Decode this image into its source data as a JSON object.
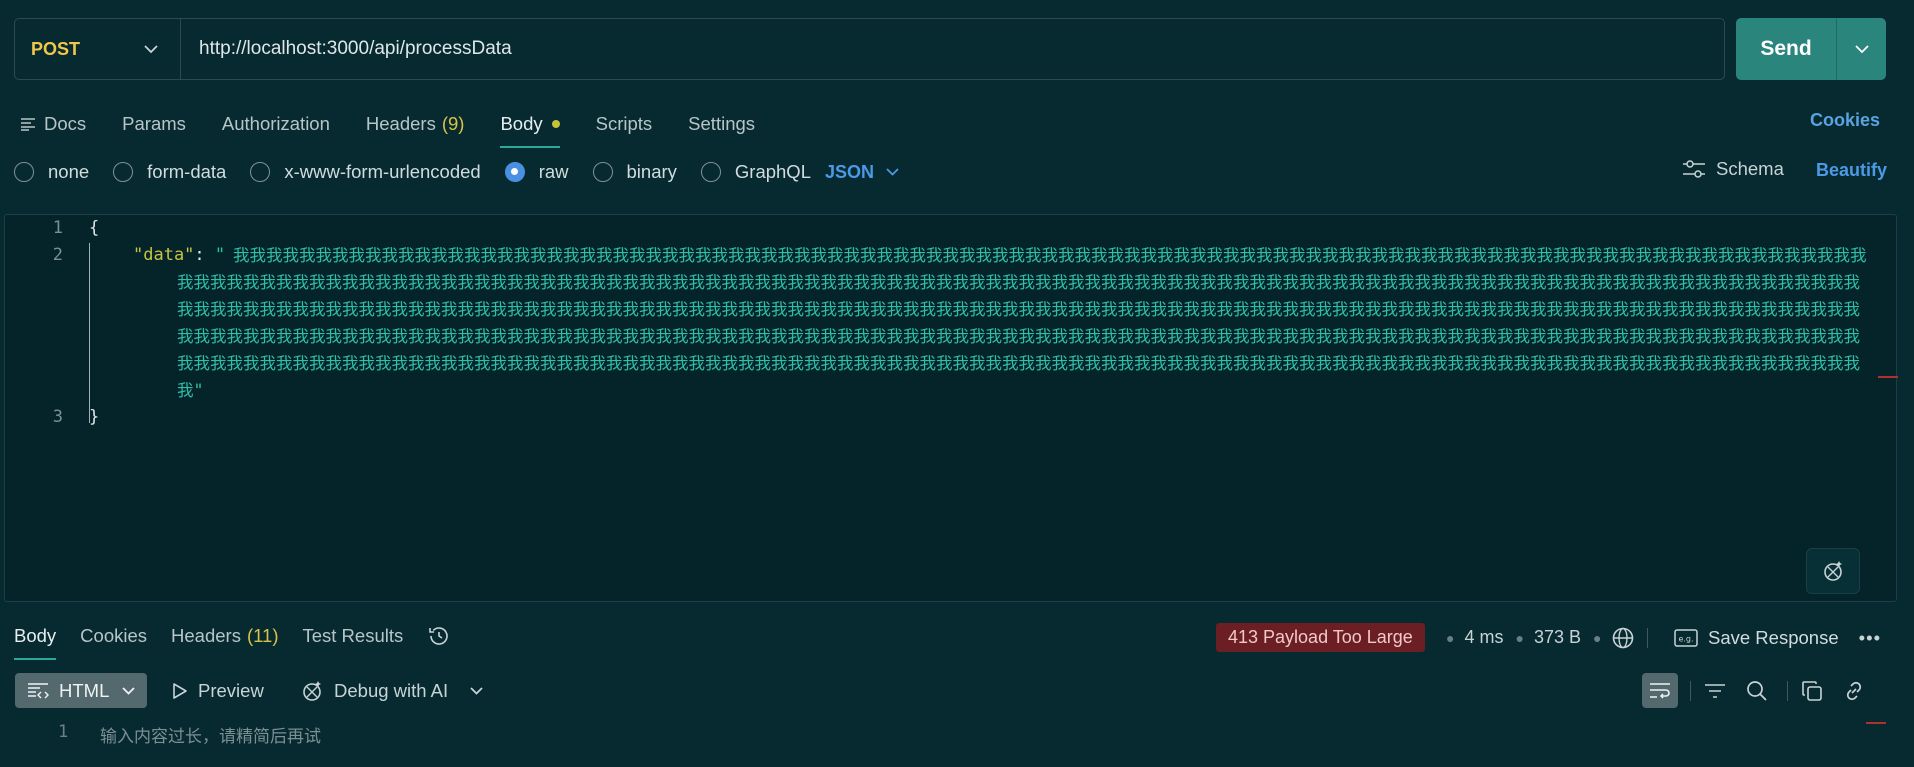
{
  "request": {
    "method": "POST",
    "url": "http://localhost:3000/api/processData",
    "send_label": "Send"
  },
  "request_tabs": [
    {
      "label": "Docs"
    },
    {
      "label": "Params"
    },
    {
      "label": "Authorization"
    },
    {
      "label": "Headers",
      "count": "(9)"
    },
    {
      "label": "Body",
      "active": true
    },
    {
      "label": "Scripts"
    },
    {
      "label": "Settings"
    }
  ],
  "cookies_link": "Cookies",
  "body_types": [
    {
      "label": "none"
    },
    {
      "label": "form-data"
    },
    {
      "label": "x-www-form-urlencoded"
    },
    {
      "label": "raw",
      "checked": true
    },
    {
      "label": "binary"
    },
    {
      "label": "GraphQL"
    }
  ],
  "raw_language": "JSON",
  "schema_label": "Schema",
  "beautify_label": "Beautify",
  "editor": {
    "line_numbers": [
      "1",
      "2",
      "3"
    ],
    "open_brace": "{",
    "key": "\"data\"",
    "colon": ": ",
    "value_open_quote": "\"",
    "value_close_quote": "\"",
    "char": "我",
    "char_count": 508,
    "close_brace": "}"
  },
  "response_tabs": [
    {
      "label": "Body",
      "active": true
    },
    {
      "label": "Cookies"
    },
    {
      "label": "Headers",
      "count": "(11)"
    },
    {
      "label": "Test Results"
    }
  ],
  "response_status": {
    "status": "413 Payload Too Large",
    "time": "4 ms",
    "size": "373 B",
    "save_label": "Save Response"
  },
  "response_toolbar": {
    "format": "HTML",
    "preview": "Preview",
    "debug": "Debug with AI"
  },
  "response_body": {
    "line_number": "1",
    "text": "输入内容过长，请精简后再试"
  },
  "colors": {
    "background": "#062a30",
    "accent": "#2a857c",
    "method": "#f0c74a",
    "link": "#4a9ae6",
    "error_badge": "#6b1e24"
  }
}
